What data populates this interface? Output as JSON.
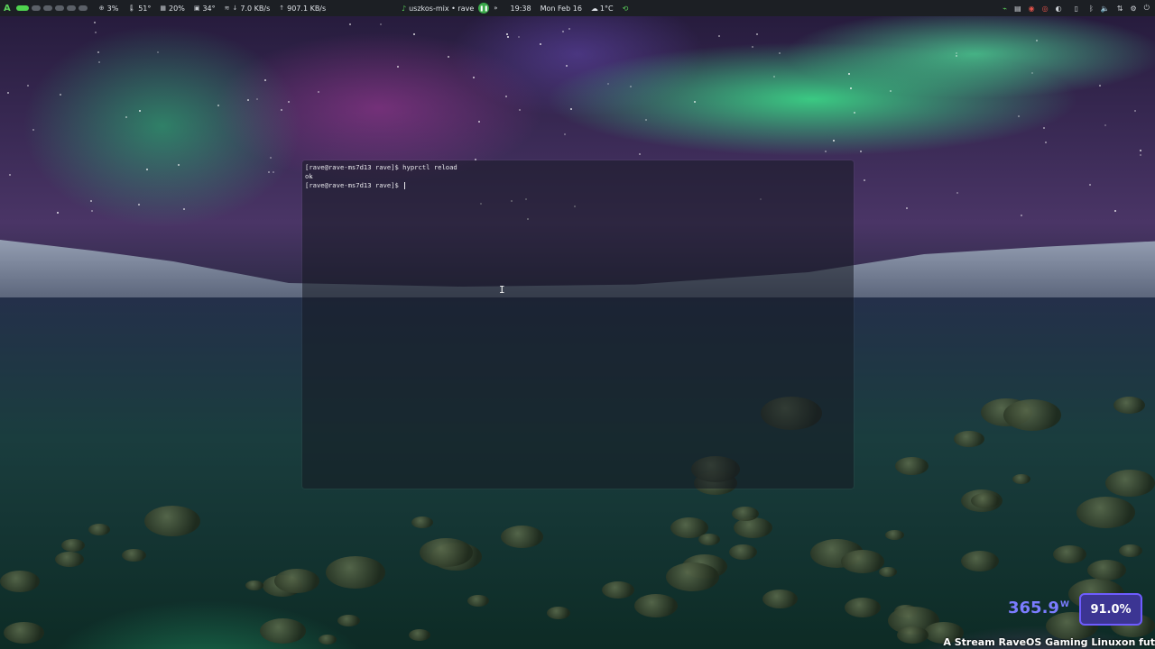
{
  "topbar": {
    "workspaces": [
      1,
      2,
      3,
      4,
      5,
      6
    ],
    "active_workspace": 1,
    "cpu": "3%",
    "cpu_temp": "51°",
    "memory": "20%",
    "gpu_temp": "34°",
    "net_down": "7.0 KB/s",
    "net_up": "907.1 KB/s",
    "media_title": "uszkos-mix • rave",
    "time": "19:38",
    "date": "Mon Feb 16",
    "weather": "1°C"
  },
  "terminal": {
    "lines": [
      "[rave@rave-ms7d13 rave]$ hyprctl reload",
      "ok",
      "[rave@rave-ms7d13 rave]$ "
    ]
  },
  "overlay": {
    "power_value": "365.9",
    "power_unit": "W",
    "percent": "91.0%",
    "ticker": "A Stream RaveOS Gaming Linuxon fut"
  },
  "colors": {
    "accent_green": "#4fd34f",
    "overlay_purple": "#6e5cff"
  },
  "icons": [
    "logo-icon",
    "cpu-icon",
    "temperature-icon",
    "memory-icon",
    "gpu-icon",
    "wifi-icon",
    "download-icon",
    "upload-icon",
    "music-icon",
    "play-icon",
    "next-icon",
    "weather-icon",
    "tray-icons"
  ]
}
